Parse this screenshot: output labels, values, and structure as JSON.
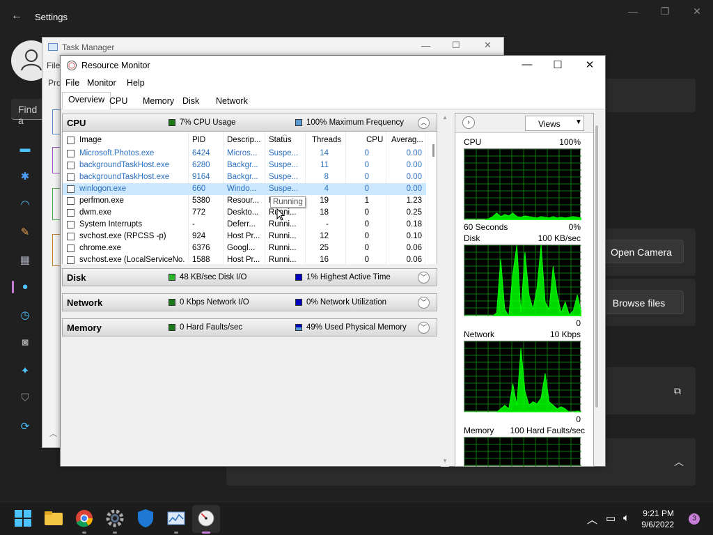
{
  "settings": {
    "title": "Settings",
    "search_placeholder": "Find a",
    "open_camera": "Open Camera",
    "browse_files": "Browse files"
  },
  "task_manager": {
    "title": "Task Manager",
    "menu_file": "File",
    "menu_pro": "Pro"
  },
  "resource_monitor": {
    "title": "Resource Monitor",
    "menu": [
      "File",
      "Monitor",
      "Help"
    ],
    "tabs": [
      "Overview",
      "CPU",
      "Memory",
      "Disk",
      "Network"
    ],
    "cpu": {
      "name": "CPU",
      "usage": "7% CPU Usage",
      "frequency": "100% Maximum Frequency",
      "columns": [
        "Image",
        "PID",
        "Descrip...",
        "Status",
        "Threads",
        "CPU",
        "Averag..."
      ],
      "rows": [
        {
          "image": "Microsoft.Photos.exe",
          "pid": "6424",
          "desc": "Micros...",
          "status": "Suspe...",
          "threads": "14",
          "cpu": "0",
          "avg": "0.00",
          "suspended": true
        },
        {
          "image": "backgroundTaskHost.exe",
          "pid": "6280",
          "desc": "Backgr...",
          "status": "Suspe...",
          "threads": "11",
          "cpu": "0",
          "avg": "0.00",
          "suspended": true
        },
        {
          "image": "backgroundTaskHost.exe",
          "pid": "9164",
          "desc": "Backgr...",
          "status": "Suspe...",
          "threads": "8",
          "cpu": "0",
          "avg": "0.00",
          "suspended": true
        },
        {
          "image": "winlogon.exe",
          "pid": "660",
          "desc": "Windo...",
          "status": "Suspe...",
          "threads": "4",
          "cpu": "0",
          "avg": "0.00",
          "suspended": true,
          "selected": true
        },
        {
          "image": "perfmon.exe",
          "pid": "5380",
          "desc": "Resour...",
          "status": "Runni...",
          "threads": "19",
          "cpu": "1",
          "avg": "1.23"
        },
        {
          "image": "dwm.exe",
          "pid": "772",
          "desc": "Deskto...",
          "status": "Runni...",
          "threads": "18",
          "cpu": "0",
          "avg": "0.25"
        },
        {
          "image": "System Interrupts",
          "pid": "-",
          "desc": "Deferr...",
          "status": "Runni...",
          "threads": "-",
          "cpu": "0",
          "avg": "0.18"
        },
        {
          "image": "svchost.exe (RPCSS -p)",
          "pid": "924",
          "desc": "Host Pr...",
          "status": "Runni...",
          "threads": "12",
          "cpu": "0",
          "avg": "0.10"
        },
        {
          "image": "chrome.exe",
          "pid": "6376",
          "desc": "Googl...",
          "status": "Runni...",
          "threads": "25",
          "cpu": "0",
          "avg": "0.06"
        },
        {
          "image": "svchost.exe (LocalServiceNo...",
          "pid": "1588",
          "desc": "Host Pr...",
          "status": "Runni...",
          "threads": "16",
          "cpu": "0",
          "avg": "0.06"
        }
      ],
      "tooltip": "Running"
    },
    "disk": {
      "name": "Disk",
      "io": "48 KB/sec Disk I/O",
      "active": "1% Highest Active Time"
    },
    "network": {
      "name": "Network",
      "io": "0 Kbps Network I/O",
      "util": "0% Network Utilization"
    },
    "memory": {
      "name": "Memory",
      "faults": "0 Hard Faults/sec",
      "used": "49% Used Physical Memory"
    },
    "views_label": "Views",
    "graphs": {
      "cpu": {
        "label": "CPU",
        "max": "100%",
        "left": "60 Seconds",
        "right": "0%"
      },
      "disk": {
        "label": "Disk",
        "max": "100 KB/sec",
        "right": "0"
      },
      "network": {
        "label": "Network",
        "max": "10 Kbps",
        "right": "0"
      },
      "memory": {
        "label": "Memory",
        "max": "100 Hard Faults/sec"
      }
    },
    "colors": {
      "cpu": "#1a7a1a",
      "freq": "#5b9bd5",
      "disk_io": "#2bb52b",
      "blue": "#0000c0",
      "graph_line": "#00ff00",
      "grid": "#0a7a0a"
    }
  },
  "taskbar": {
    "time": "9:21 PM",
    "date": "9/6/2022",
    "notifications": "3"
  }
}
